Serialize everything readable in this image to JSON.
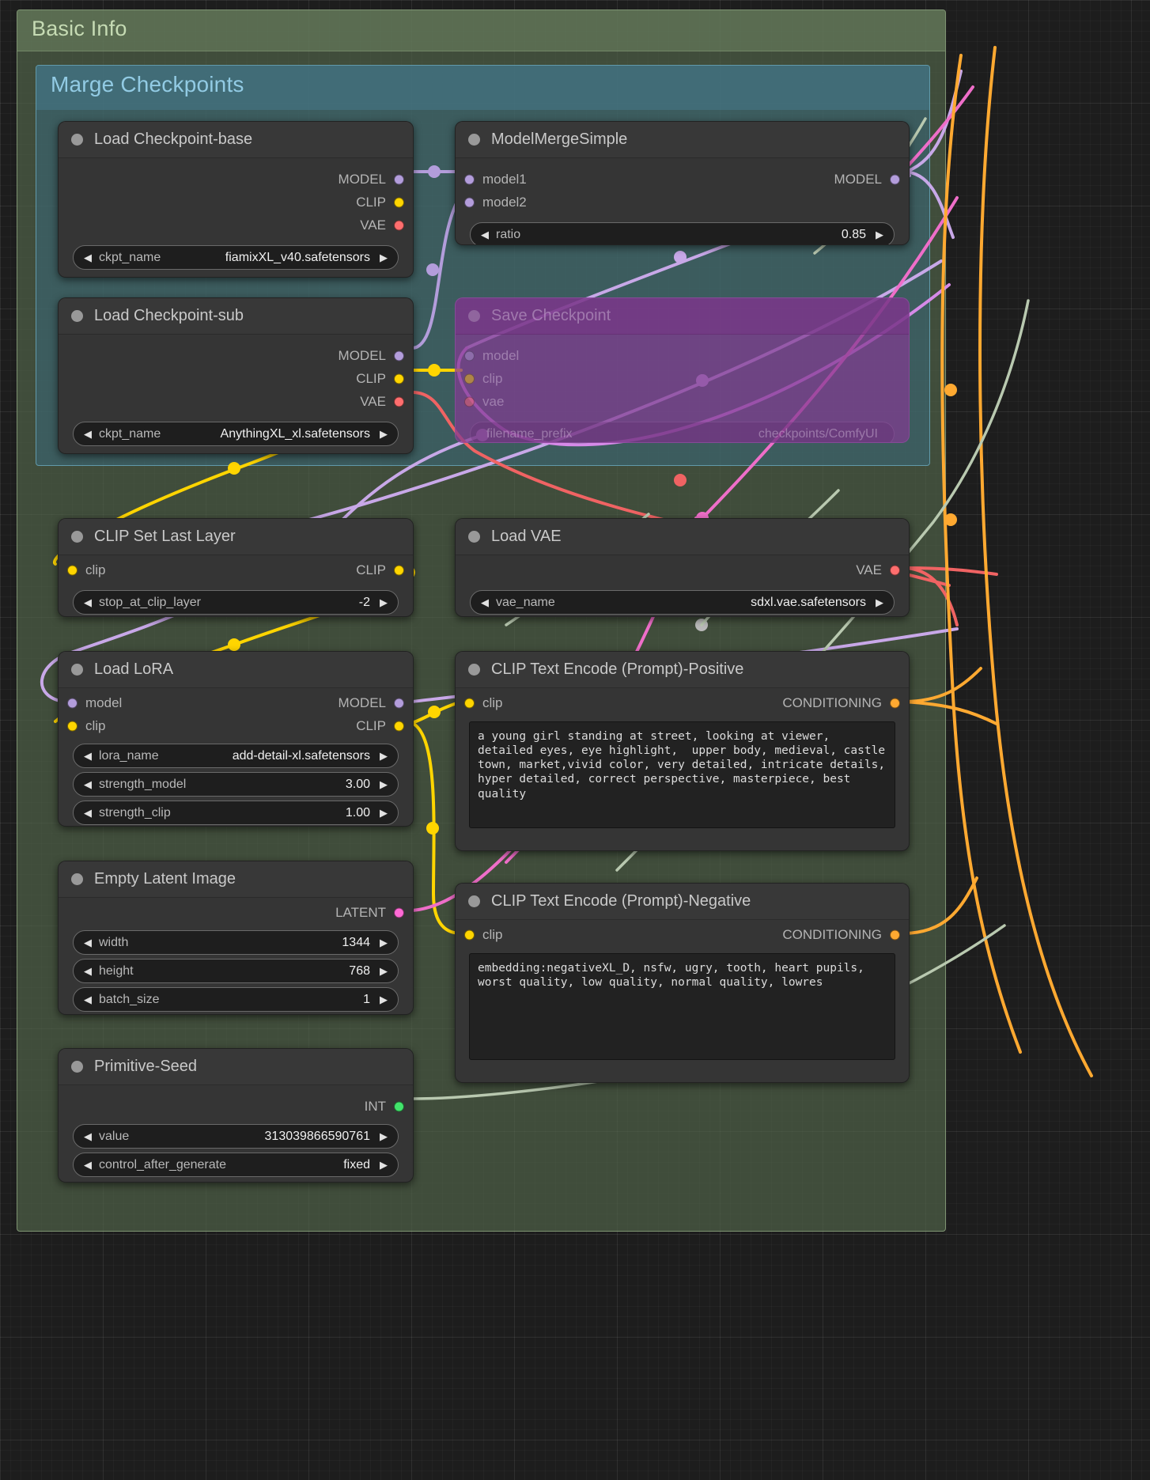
{
  "groups": [
    {
      "title": "Basic Info"
    },
    {
      "title": "Marge Checkpoints"
    }
  ],
  "nodes": {
    "load_ckpt_base": {
      "title": "Load Checkpoint-base",
      "outputs": [
        "MODEL",
        "CLIP",
        "VAE"
      ],
      "widgets": [
        {
          "name": "ckpt_name",
          "value": "fiamixXL_v40.safetensors"
        }
      ]
    },
    "model_merge_simple": {
      "title": "ModelMergeSimple",
      "inputs": [
        "model1",
        "model2"
      ],
      "outputs": [
        "MODEL"
      ],
      "widgets": [
        {
          "name": "ratio",
          "value": "0.85"
        }
      ]
    },
    "load_ckpt_sub": {
      "title": "Load Checkpoint-sub",
      "outputs": [
        "MODEL",
        "CLIP",
        "VAE"
      ],
      "widgets": [
        {
          "name": "ckpt_name",
          "value": "AnythingXL_xl.safetensors"
        }
      ]
    },
    "save_checkpoint": {
      "title": "Save Checkpoint",
      "inputs": [
        "model",
        "clip",
        "vae"
      ],
      "widgets": [
        {
          "name": "filename_prefix",
          "value": "checkpoints/ComfyUI"
        }
      ]
    },
    "clip_set_last_layer": {
      "title": "CLIP Set Last Layer",
      "inputs": [
        "clip"
      ],
      "outputs": [
        "CLIP"
      ],
      "widgets": [
        {
          "name": "stop_at_clip_layer",
          "value": "-2"
        }
      ]
    },
    "load_vae": {
      "title": "Load VAE",
      "outputs": [
        "VAE"
      ],
      "widgets": [
        {
          "name": "vae_name",
          "value": "sdxl.vae.safetensors"
        }
      ]
    },
    "load_lora": {
      "title": "Load LoRA",
      "inputs": [
        "model",
        "clip"
      ],
      "outputs": [
        "MODEL",
        "CLIP"
      ],
      "widgets": [
        {
          "name": "lora_name",
          "value": "add-detail-xl.safetensors"
        },
        {
          "name": "strength_model",
          "value": "3.00"
        },
        {
          "name": "strength_clip",
          "value": "1.00"
        }
      ]
    },
    "clip_text_positive": {
      "title": "CLIP Text Encode (Prompt)-Positive",
      "inputs": [
        "clip"
      ],
      "outputs": [
        "CONDITIONING"
      ],
      "text": "a young girl standing at street, looking at viewer, detailed eyes, eye highlight,  upper body, medieval, castle town, market,vivid color, very detailed, intricate details, hyper detailed, correct perspective, masterpiece, best quality"
    },
    "clip_text_negative": {
      "title": "CLIP Text Encode (Prompt)-Negative",
      "inputs": [
        "clip"
      ],
      "outputs": [
        "CONDITIONING"
      ],
      "text": "embedding:negativeXL_D, nsfw, ugry, tooth, heart pupils, worst quality, low quality, normal quality, lowres"
    },
    "empty_latent_image": {
      "title": "Empty Latent Image",
      "outputs": [
        "LATENT"
      ],
      "widgets": [
        {
          "name": "width",
          "value": "1344"
        },
        {
          "name": "height",
          "value": "768"
        },
        {
          "name": "batch_size",
          "value": "1"
        }
      ]
    },
    "primitive_seed": {
      "title": "Primitive-Seed",
      "outputs": [
        "INT"
      ],
      "widgets": [
        {
          "name": "value",
          "value": "313039866590761"
        },
        {
          "name": "control_after_generate",
          "value": "fixed"
        }
      ]
    }
  },
  "icons": {
    "collapse": "collapse-dot-icon",
    "arrow_left": "◀",
    "arrow_right": "▶"
  },
  "colors": {
    "model": "#b39ddb",
    "clip": "#ffd500",
    "vae": "#ff6e6e",
    "conditioning": "#ffa931",
    "latent": "#ff6ad5",
    "int": "#42e36b",
    "group_basic": "#566a4e",
    "group_merge": "#386a7c",
    "node_bg": "#353535",
    "bypassed": "#823c91"
  }
}
